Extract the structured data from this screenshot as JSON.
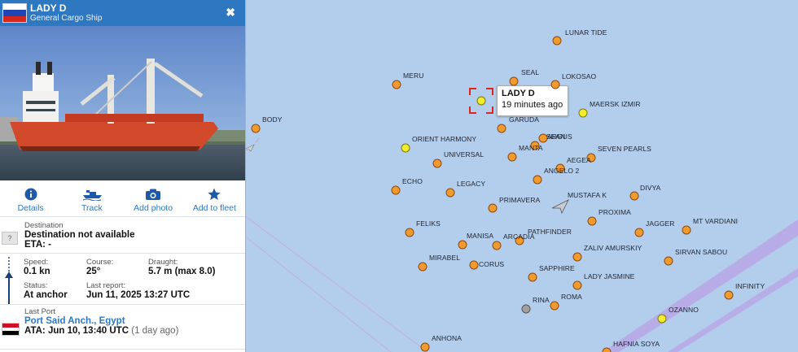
{
  "vessel": {
    "name": "LADY D",
    "type": "General Cargo Ship",
    "flag_colors": [
      "#ffffff",
      "#1f45b5",
      "#d5261c"
    ]
  },
  "close_label": "✖",
  "actions": [
    {
      "label": "Details",
      "icon": "info-icon"
    },
    {
      "label": "Track",
      "icon": "ship-track-icon"
    },
    {
      "label": "Add photo",
      "icon": "camera-icon"
    },
    {
      "label": "Add to fleet",
      "icon": "star-icon"
    }
  ],
  "destination": {
    "label": "Destination",
    "value": "Destination not available",
    "eta_text": "ETA: -",
    "placeholder_icon": "?"
  },
  "voyage": {
    "speed_label": "Speed:",
    "speed_value": "0.1 kn",
    "course_label": "Course:",
    "course_value": "25°",
    "draught_label": "Draught:",
    "draught_value": "5.7 m (max 8.0)",
    "status_label": "Status:",
    "status_value": "At anchor",
    "report_label": "Last report:",
    "report_value": "Jun 11, 2025 13:27 UTC"
  },
  "last_port": {
    "label": "Last Port",
    "name": "Port Said Anch., Egypt",
    "ata_text": "ATA: Jun 10, 13:40 UTC",
    "ata_relative": "(1 day ago)"
  },
  "tooltip": {
    "name": "LADY D",
    "time": "19 minutes ago"
  },
  "colors": {
    "accent": "#2e78c2",
    "map_water": "#b3cdec",
    "ship_orange": "#f39a2e",
    "ship_yellow": "#f2ec2a",
    "selected": "#e0231c"
  },
  "ships": [
    {
      "name": "LUNAR TIDE",
      "color": "orange"
    },
    {
      "name": "MERU",
      "color": "orange"
    },
    {
      "name": "SEAL",
      "color": "orange"
    },
    {
      "name": "LOKOSAO",
      "color": "orange"
    },
    {
      "name": "BODY",
      "color": "orange"
    },
    {
      "name": "MAERSK IZMIR",
      "color": "yellow"
    },
    {
      "name": "GARUDA",
      "color": "orange"
    },
    {
      "name": "ORIENT HARMONY",
      "color": "yellow"
    },
    {
      "name": "ASEAN",
      "color": "orange"
    },
    {
      "name": "ARGUS",
      "color": "orange"
    },
    {
      "name": "MANTA",
      "color": "orange"
    },
    {
      "name": "SEVEN PEARLS",
      "color": "orange"
    },
    {
      "name": "UNIVERSAL",
      "color": "orange"
    },
    {
      "name": "AEGEA",
      "color": "orange"
    },
    {
      "name": "ANGELO 2",
      "color": "orange"
    },
    {
      "name": "ECHO",
      "color": "orange"
    },
    {
      "name": "LEGACY",
      "color": "orange"
    },
    {
      "name": "DIVYA",
      "color": "orange"
    },
    {
      "name": "MUSTAFA K",
      "color": "none"
    },
    {
      "name": "PRIMAVERA",
      "color": "orange"
    },
    {
      "name": "PROXIMA",
      "color": "orange"
    },
    {
      "name": "FELIKS",
      "color": "orange"
    },
    {
      "name": "JAGGER",
      "color": "orange"
    },
    {
      "name": "MT VARDIANI",
      "color": "orange"
    },
    {
      "name": "PATHFINDER",
      "color": "orange"
    },
    {
      "name": "MANISA",
      "color": "orange"
    },
    {
      "name": "ARCADIA",
      "color": "orange"
    },
    {
      "name": "ZALIV AMURSKIY",
      "color": "orange"
    },
    {
      "name": "SIRVAN SABOU",
      "color": "orange"
    },
    {
      "name": "MIRABEL",
      "color": "orange"
    },
    {
      "name": "CORUS",
      "color": "orange"
    },
    {
      "name": "SAPPHIRE",
      "color": "orange"
    },
    {
      "name": "LADY JASMINE",
      "color": "orange"
    },
    {
      "name": "INFINITY",
      "color": "orange"
    },
    {
      "name": "RINA",
      "color": "grey"
    },
    {
      "name": "ROMA",
      "color": "orange"
    },
    {
      "name": "OZANNO",
      "color": "yellow"
    },
    {
      "name": "ANHONA",
      "color": "orange"
    },
    {
      "name": "HAFNIA SOYA",
      "color": "orange"
    }
  ]
}
